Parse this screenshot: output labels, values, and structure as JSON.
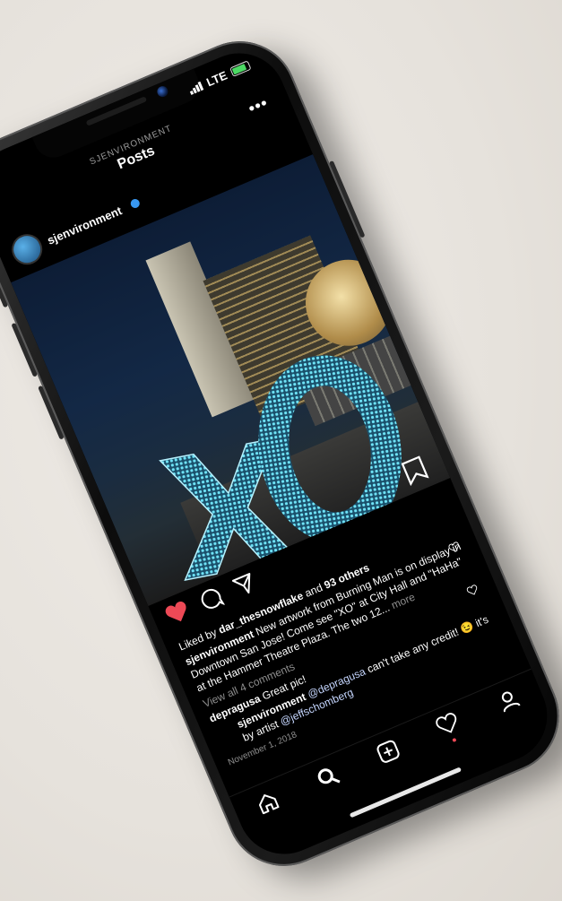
{
  "status_bar": {
    "network": "LTE"
  },
  "header": {
    "account": "SJENVIRONMENT",
    "title": "Posts",
    "more_label": "•••"
  },
  "post": {
    "username": "sjenvironment",
    "likes": {
      "prefix": "Liked by ",
      "user": "dar_thesnowflake",
      "middle": " and ",
      "others": "93 others"
    },
    "caption": {
      "user": "sjenvironment",
      "text": " New artwork from Burning Man is on display in Downtown San Jose! Come see \"XO\" at City Hall and \"HaHa\" at the Hammer Theatre Plaza. The two 12...",
      "more": " more"
    },
    "view_comments": "View all 4 comments",
    "comments": [
      {
        "user": "depragusa",
        "text": " Great pic!"
      },
      {
        "user": "sjenvironment",
        "mention": " @depragusa",
        "text": " can't take any credit! 😉 it's by artist ",
        "mention2": "@jeffschomberg"
      }
    ],
    "date": "November 1, 2018"
  },
  "colors": {
    "like": "#ed4956",
    "verified": "#3897f0",
    "led": "#4fc3e3"
  },
  "icons": [
    "heart-icon",
    "comment-icon",
    "share-icon",
    "bookmark-icon",
    "home-icon",
    "search-icon",
    "add-icon",
    "activity-icon",
    "profile-icon"
  ]
}
